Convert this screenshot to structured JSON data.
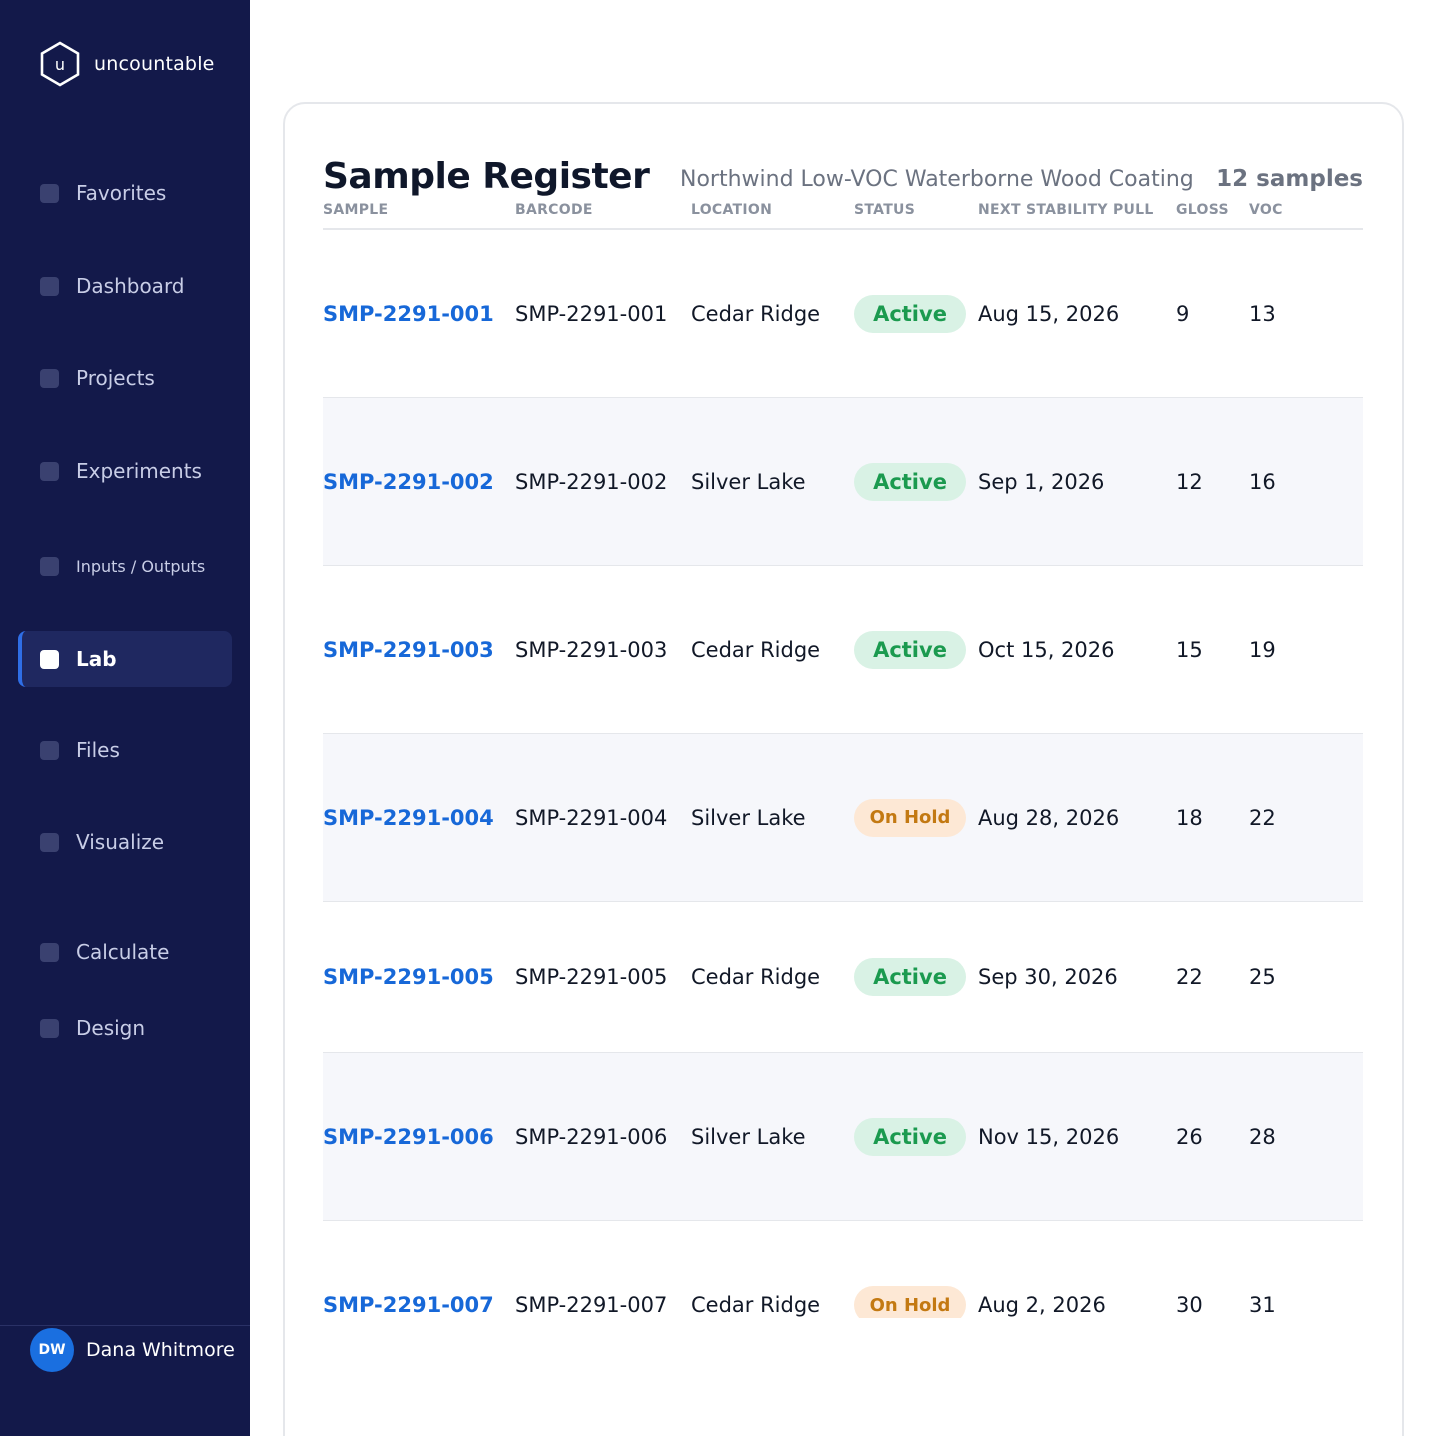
{
  "app": {
    "logo_letter": "u",
    "logo_name": "uncountable"
  },
  "sidebar": {
    "items": [
      {
        "label": "Favorites",
        "icon": "star-icon"
      },
      {
        "label": "Dashboard",
        "icon": "dashboard-icon"
      },
      {
        "label": "Projects",
        "icon": "folder-icon"
      },
      {
        "label": "Experiments",
        "icon": "flask-icon"
      },
      {
        "label": "Inputs / Outputs",
        "icon": "io-icon"
      },
      {
        "label": "Lab",
        "icon": "lab-icon",
        "active": true
      },
      {
        "label": "Files",
        "icon": "file-icon"
      },
      {
        "label": "Visualize",
        "icon": "chart-icon"
      },
      {
        "label": "Calculate",
        "icon": "calculator-icon"
      },
      {
        "label": "Design",
        "icon": "design-icon"
      }
    ],
    "user": {
      "initials": "DW",
      "name": "Dana Whitmore"
    }
  },
  "register": {
    "title": "Sample Register",
    "subtitle": "Northwind Low-VOC Waterborne Wood Coating",
    "count": "12 samples",
    "columns": [
      "SAMPLE",
      "BARCODE",
      "LOCATION",
      "STATUS",
      "NEXT STABILITY PULL",
      "GLOSS",
      "VOC"
    ],
    "rows": [
      {
        "sample": "SMP-2291-001",
        "barcode": "SMP-2291-001",
        "location": "Cedar Ridge",
        "status": "Active",
        "pull": "Aug 15, 2026",
        "gloss": "9",
        "voc": "13"
      },
      {
        "sample": "SMP-2291-002",
        "barcode": "SMP-2291-002",
        "location": "Silver Lake",
        "status": "Active",
        "pull": "Sep 1, 2026",
        "gloss": "12",
        "voc": "16"
      },
      {
        "sample": "SMP-2291-003",
        "barcode": "SMP-2291-003",
        "location": "Cedar Ridge",
        "status": "Active",
        "pull": "Oct 15, 2026",
        "gloss": "15",
        "voc": "19"
      },
      {
        "sample": "SMP-2291-004",
        "barcode": "SMP-2291-004",
        "location": "Silver Lake",
        "status": "On Hold",
        "pull": "Aug 28, 2026",
        "gloss": "18",
        "voc": "22"
      },
      {
        "sample": "SMP-2291-005",
        "barcode": "SMP-2291-005",
        "location": "Cedar Ridge",
        "status": "Active",
        "pull": "Sep 30, 2026",
        "gloss": "22",
        "voc": "25"
      },
      {
        "sample": "SMP-2291-006",
        "barcode": "SMP-2291-006",
        "location": "Silver Lake",
        "status": "Active",
        "pull": "Nov 15, 2026",
        "gloss": "26",
        "voc": "28"
      },
      {
        "sample": "SMP-2291-007",
        "barcode": "SMP-2291-007",
        "location": "Cedar Ridge",
        "status": "On Hold",
        "pull": "Aug 2, 2026",
        "gloss": "30",
        "voc": "31"
      }
    ]
  },
  "colors": {
    "sidebar_bg": "#13194a",
    "link": "#1768d8",
    "active_badge": "#1b9a4f",
    "hold_badge": "#c37912"
  }
}
